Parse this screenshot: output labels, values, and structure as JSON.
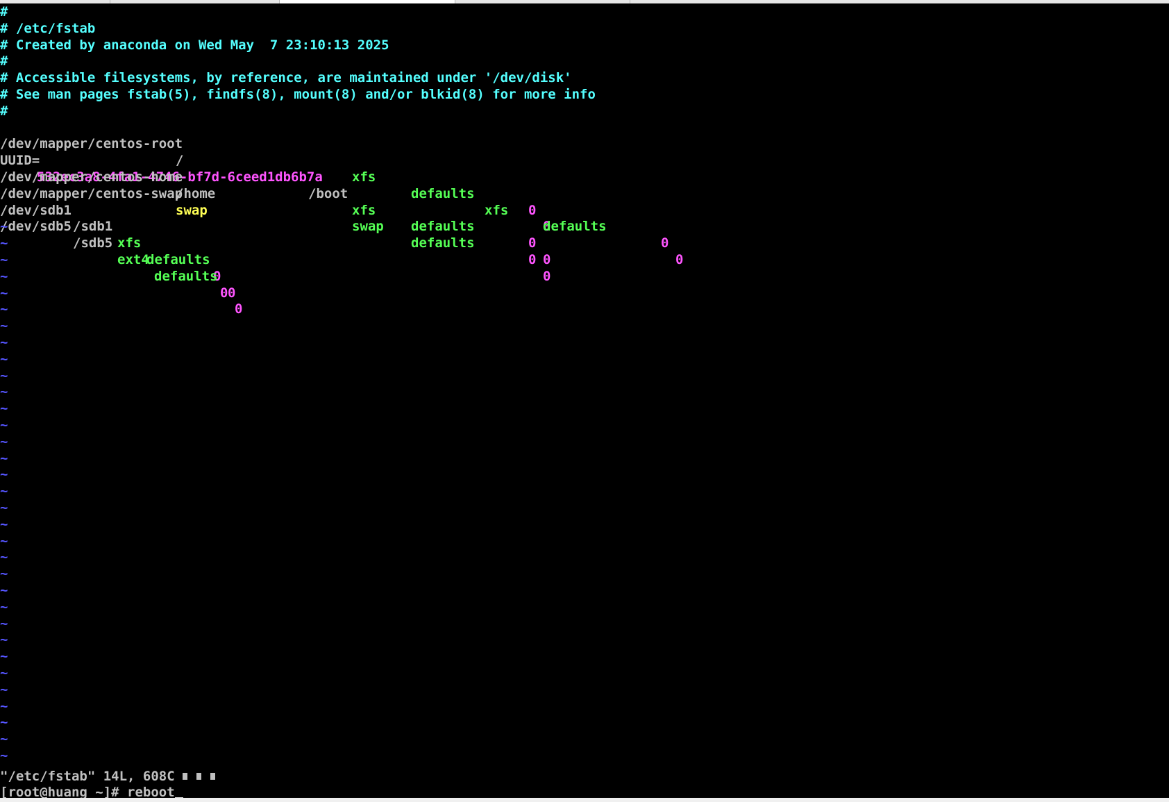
{
  "terminal": {
    "comments": [
      "#",
      "# /etc/fstab",
      "# Created by anaconda on Wed May  7 23:10:13 2025",
      "#",
      "# Accessible filesystems, by reference, are maintained under '/dev/disk'",
      "# See man pages fstab(5), findfs(8), mount(8) and/or blkid(8) for more info",
      "#"
    ],
    "entries": [
      {
        "device": "/dev/mapper/centos-root",
        "mount": "/",
        "fstype": "xfs",
        "options": "defaults",
        "dump": "0",
        "pass": "0"
      },
      {
        "uuid_label": "UUID=",
        "uuid_value": "532ec3a8-4fa1-4746-bf7d-6ceed1db6b7a",
        "mount": "/boot",
        "fstype": "xfs",
        "options": "defaults",
        "dump": "0",
        "pass": "0"
      },
      {
        "device": "/dev/mapper/centos-home",
        "mount": "/home",
        "fstype": "xfs",
        "options": "defaults",
        "dump": "0",
        "pass": "0"
      },
      {
        "device": "/dev/mapper/centos-swap",
        "mount": "swap",
        "fstype": "swap",
        "options": "defaults",
        "dump": "0",
        "pass": "0"
      },
      {
        "device": "/dev/sdb1",
        "mount": "/sdb1",
        "fstype": "xfs",
        "options": "defaults",
        "dump": "0",
        "pass": "0"
      },
      {
        "device": "/dev/sdb5",
        "mount": "/sdb5",
        "fstype": "ext4",
        "options": "defaults",
        "dump": "0",
        "pass": "0"
      }
    ],
    "tilde": "~",
    "status_line": "\"/etc/fstab\" 14L, 608C",
    "prompt": "[root@huang ~]# ",
    "command": "reboot"
  },
  "colors": {
    "background": "#000000",
    "comment": "#55ffff",
    "text": "#c0c0c0",
    "keyword": "#55ff55",
    "number": "#ff55ff",
    "special": "#ffff55",
    "tilde": "#5555ff"
  }
}
